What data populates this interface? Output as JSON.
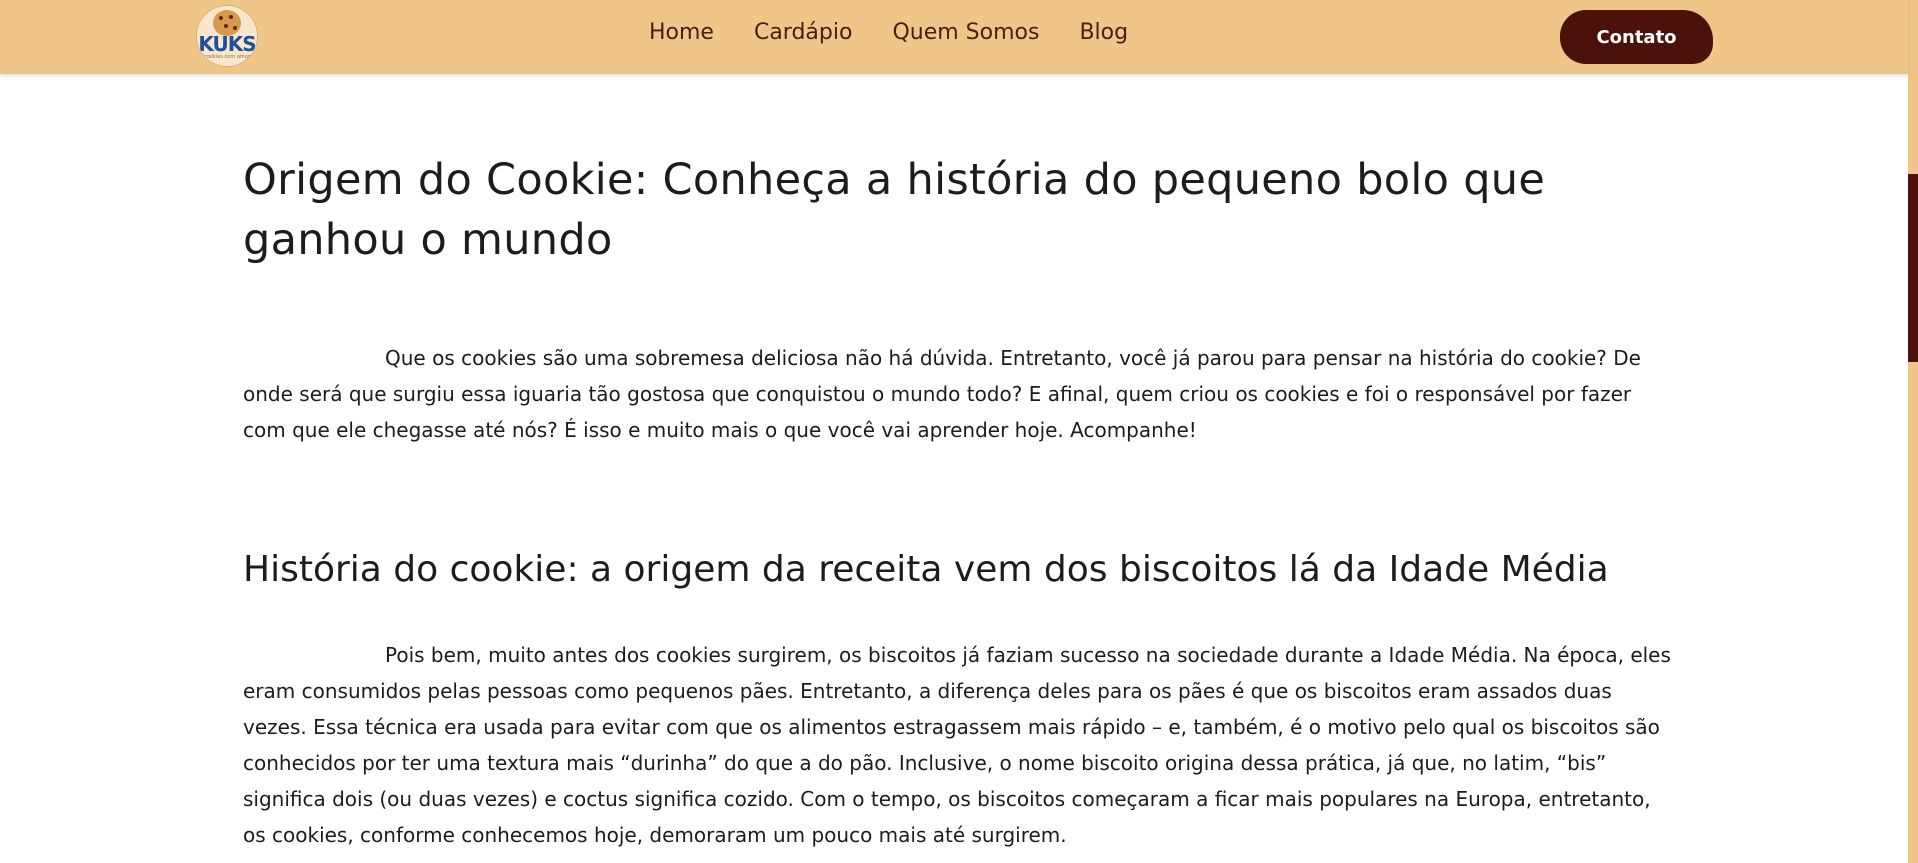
{
  "nav": {
    "logo_text": "KUKS",
    "logo_tagline": "cookies com amor",
    "links": [
      "Home",
      "Cardápio",
      "Quem Somos",
      "Blog"
    ],
    "contact_label": "Contato"
  },
  "article": {
    "title": "Origem do Cookie: Conheça a história do pequeno bolo que ganhou o mundo",
    "intro": "Que os cookies são uma sobremesa deliciosa não há dúvida. Entretanto, você já parou para pensar na história do cookie? De onde será que surgiu essa iguaria tão gostosa que conquistou o mundo todo? E afinal, quem criou os cookies e foi o responsável por fazer com que ele chegasse até nós? É isso e muito mais o que você vai aprender hoje. Acompanhe!",
    "section_title": "História do cookie: a origem da receita vem dos biscoitos lá da Idade Média",
    "section_text": "Pois bem, muito antes dos cookies surgirem, os biscoitos já faziam sucesso na sociedade durante a Idade Média. Na época, eles eram consumidos pelas pessoas como pequenos pães. Entretanto, a diferença deles para os pães é que os biscoitos eram assados duas vezes. Essa técnica era usada para evitar com que os alimentos estragassem mais rápido – e, também, é o motivo pelo qual os biscoitos são conhecidos por ter uma textura mais “durinha” do que a do pão. Inclusive, o nome biscoito origina dessa prática, já que, no latim, “bis” significa dois (ou duas vezes) e coctus significa cozido. Com o tempo, os biscoitos começaram a ficar mais populares na Europa, entretanto, os cookies, conforme conhecemos hoje, demoraram um pouco mais até surgirem."
  },
  "colors": {
    "navbar_bg": "#efc588",
    "accent_dark": "#4c110b",
    "nav_text": "#4a1e12",
    "body_text": "#1c1c1c"
  },
  "icons": {
    "logo": "cookie-logo-icon"
  }
}
